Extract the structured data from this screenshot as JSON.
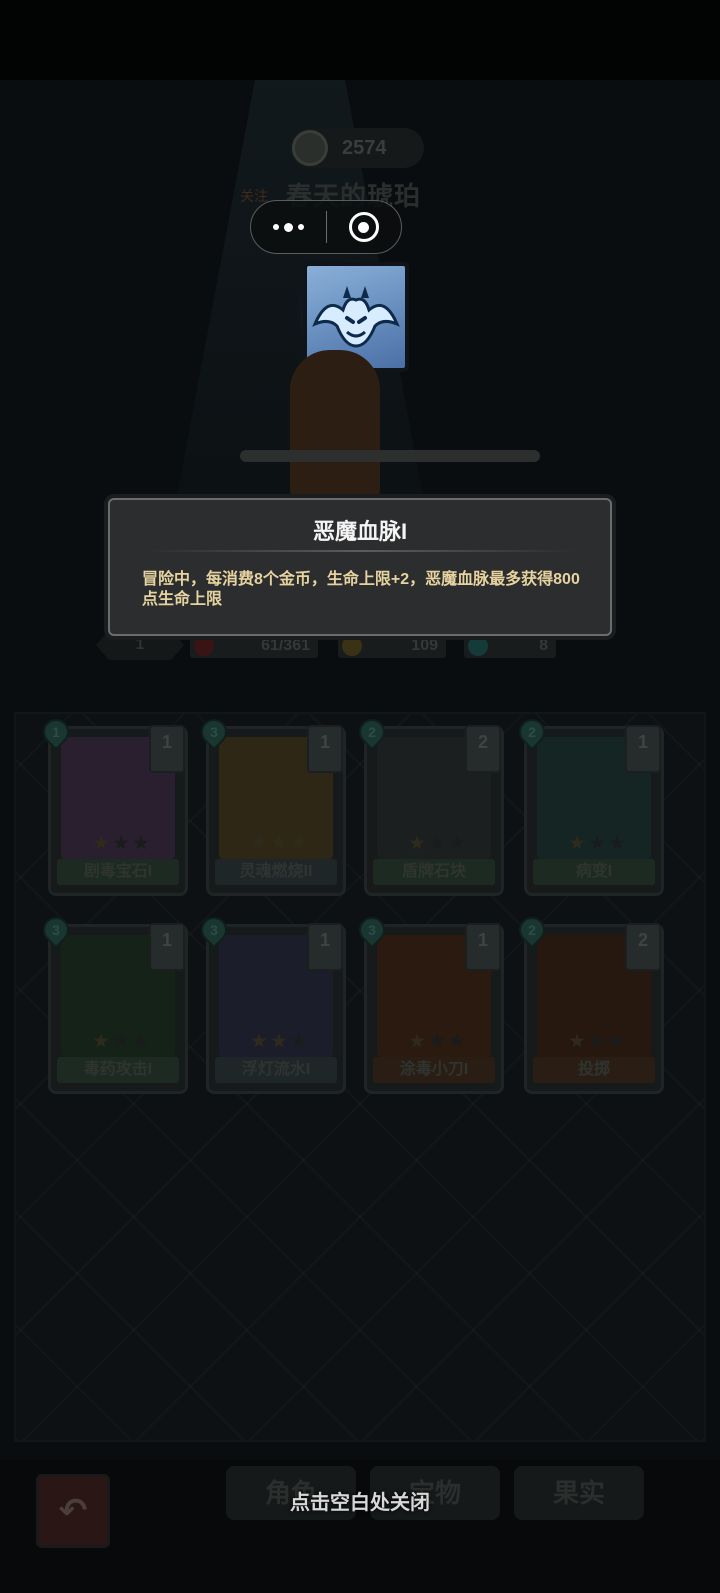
{
  "header": {
    "coins": "2574",
    "follow_label": "关注",
    "player_name": "春天的琥珀"
  },
  "tooltip": {
    "title": "恶魔血脉I",
    "description": "冒险中，每消费8个金币，生命上限+2，恶魔血脉最多获得800点生命上限"
  },
  "stats": {
    "level": "1",
    "hp": "61/361",
    "attack": "109",
    "gems": "8"
  },
  "cards": [
    {
      "name": "剧毒宝石I",
      "cost": "1",
      "level": "1",
      "stars": 1,
      "rarity": "rare",
      "art_color": "#2a1f2e"
    },
    {
      "name": "灵魂燃烧II",
      "cost": "3",
      "level": "1",
      "stars": 3,
      "rarity": "epic",
      "art_color": "#2e2716"
    },
    {
      "name": "盾牌石块",
      "cost": "2",
      "level": "2",
      "stars": 1,
      "rarity": "rare",
      "art_color": "#1b1f20"
    },
    {
      "name": "病变I",
      "cost": "2",
      "level": "1",
      "stars": 1,
      "rarity": "rare",
      "art_color": "#142523"
    },
    {
      "name": "毒药攻击I",
      "cost": "3",
      "level": "1",
      "stars": 1,
      "rarity": "rare",
      "art_color": "#152218"
    },
    {
      "name": "浮灯流水I",
      "cost": "3",
      "level": "1",
      "stars": 2,
      "rarity": "epic",
      "art_color": "#1c1d2a"
    },
    {
      "name": "涂毒小刀I",
      "cost": "3",
      "level": "1",
      "stars": 1,
      "rarity": "gold",
      "art_color": "#2a1a10"
    },
    {
      "name": "投掷",
      "cost": "2",
      "level": "2",
      "stars": 1,
      "rarity": "gold",
      "art_color": "#26170f"
    }
  ],
  "bottom": {
    "close_hint": "点击空白处关闭",
    "tabs": [
      "角色",
      "宝物",
      "果实"
    ]
  }
}
